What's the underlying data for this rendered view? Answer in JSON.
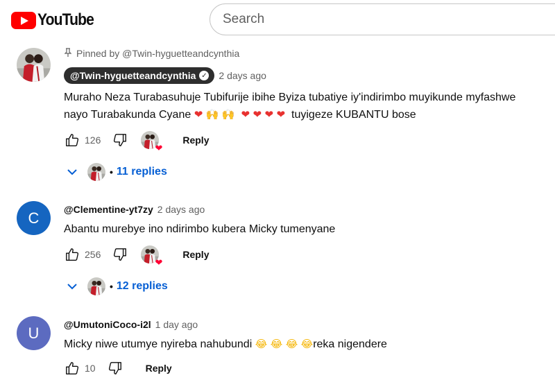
{
  "header": {
    "logo_text": "YouTube",
    "search_placeholder": "Search"
  },
  "comments": [
    {
      "pinned_label": "Pinned by @Twin-hyguetteandcynthia",
      "author": "@Twin-hyguetteandcynthia",
      "time": "2 days ago",
      "text_line1": "Muraho Neza Turabasuhuje Tubifurije ibihe Byiza tubatiye iy'indirimbo muyikunde myfashwe",
      "text_line2_start": "nayo Turabakunda Cyane",
      "text_line2_end": "tuyigeze KUBANTU bose",
      "likes": "126",
      "reply_label": "Reply",
      "replies_label": "11 replies"
    },
    {
      "avatar_letter": "C",
      "avatar_color": "#1565c0",
      "author": "@Clementine-yt7zy",
      "time": "2 days ago",
      "text": "Abantu murebye ino ndirimbo kubera Micky tumenyane",
      "likes": "256",
      "reply_label": "Reply",
      "replies_label": "12 replies"
    },
    {
      "avatar_letter": "U",
      "avatar_color": "#5c6bc0",
      "author": "@UmutoniCoco-i2l",
      "time": "1 day ago",
      "text_start": "Micky niwe utumye nyireba nahubundi",
      "text_end": "reka nigendere",
      "likes": "10",
      "reply_label": "Reply"
    }
  ],
  "icons": {
    "like": "thumbs-up-icon",
    "dislike": "thumbs-down-icon",
    "pin": "pin-icon",
    "verified": "verified-check-icon",
    "expand": "chevron-down-icon",
    "creator_heart": "heart-icon"
  },
  "colors": {
    "brand_red": "#ff0000",
    "link_blue": "#065fd4",
    "heart_red": "#ff0033"
  }
}
